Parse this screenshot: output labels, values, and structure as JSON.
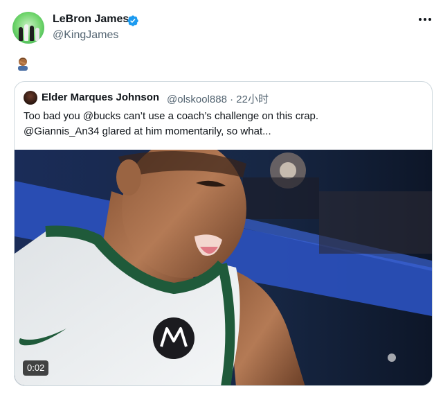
{
  "tweet": {
    "author": {
      "name": "LeBron James",
      "handle": "@KingJames",
      "verified": true
    },
    "emoji_icon": "person-facepalming-emoji",
    "more_icon": "more-options-icon"
  },
  "quoted_tweet": {
    "author": {
      "name": "Elder Marques Johnson",
      "handle_time": "@olskool888 · 22小时"
    },
    "text_line1": "Too bad you @bucks can’t use a coach’s challenge on this crap.",
    "text_line2": "@Giannis_An34 glared at him momentarily, so what...",
    "media": {
      "type": "video",
      "duration": "0:02"
    }
  },
  "colors": {
    "verified_blue": "#1d9bf0",
    "handle_gray": "#536471",
    "border": "#cfd9de"
  }
}
